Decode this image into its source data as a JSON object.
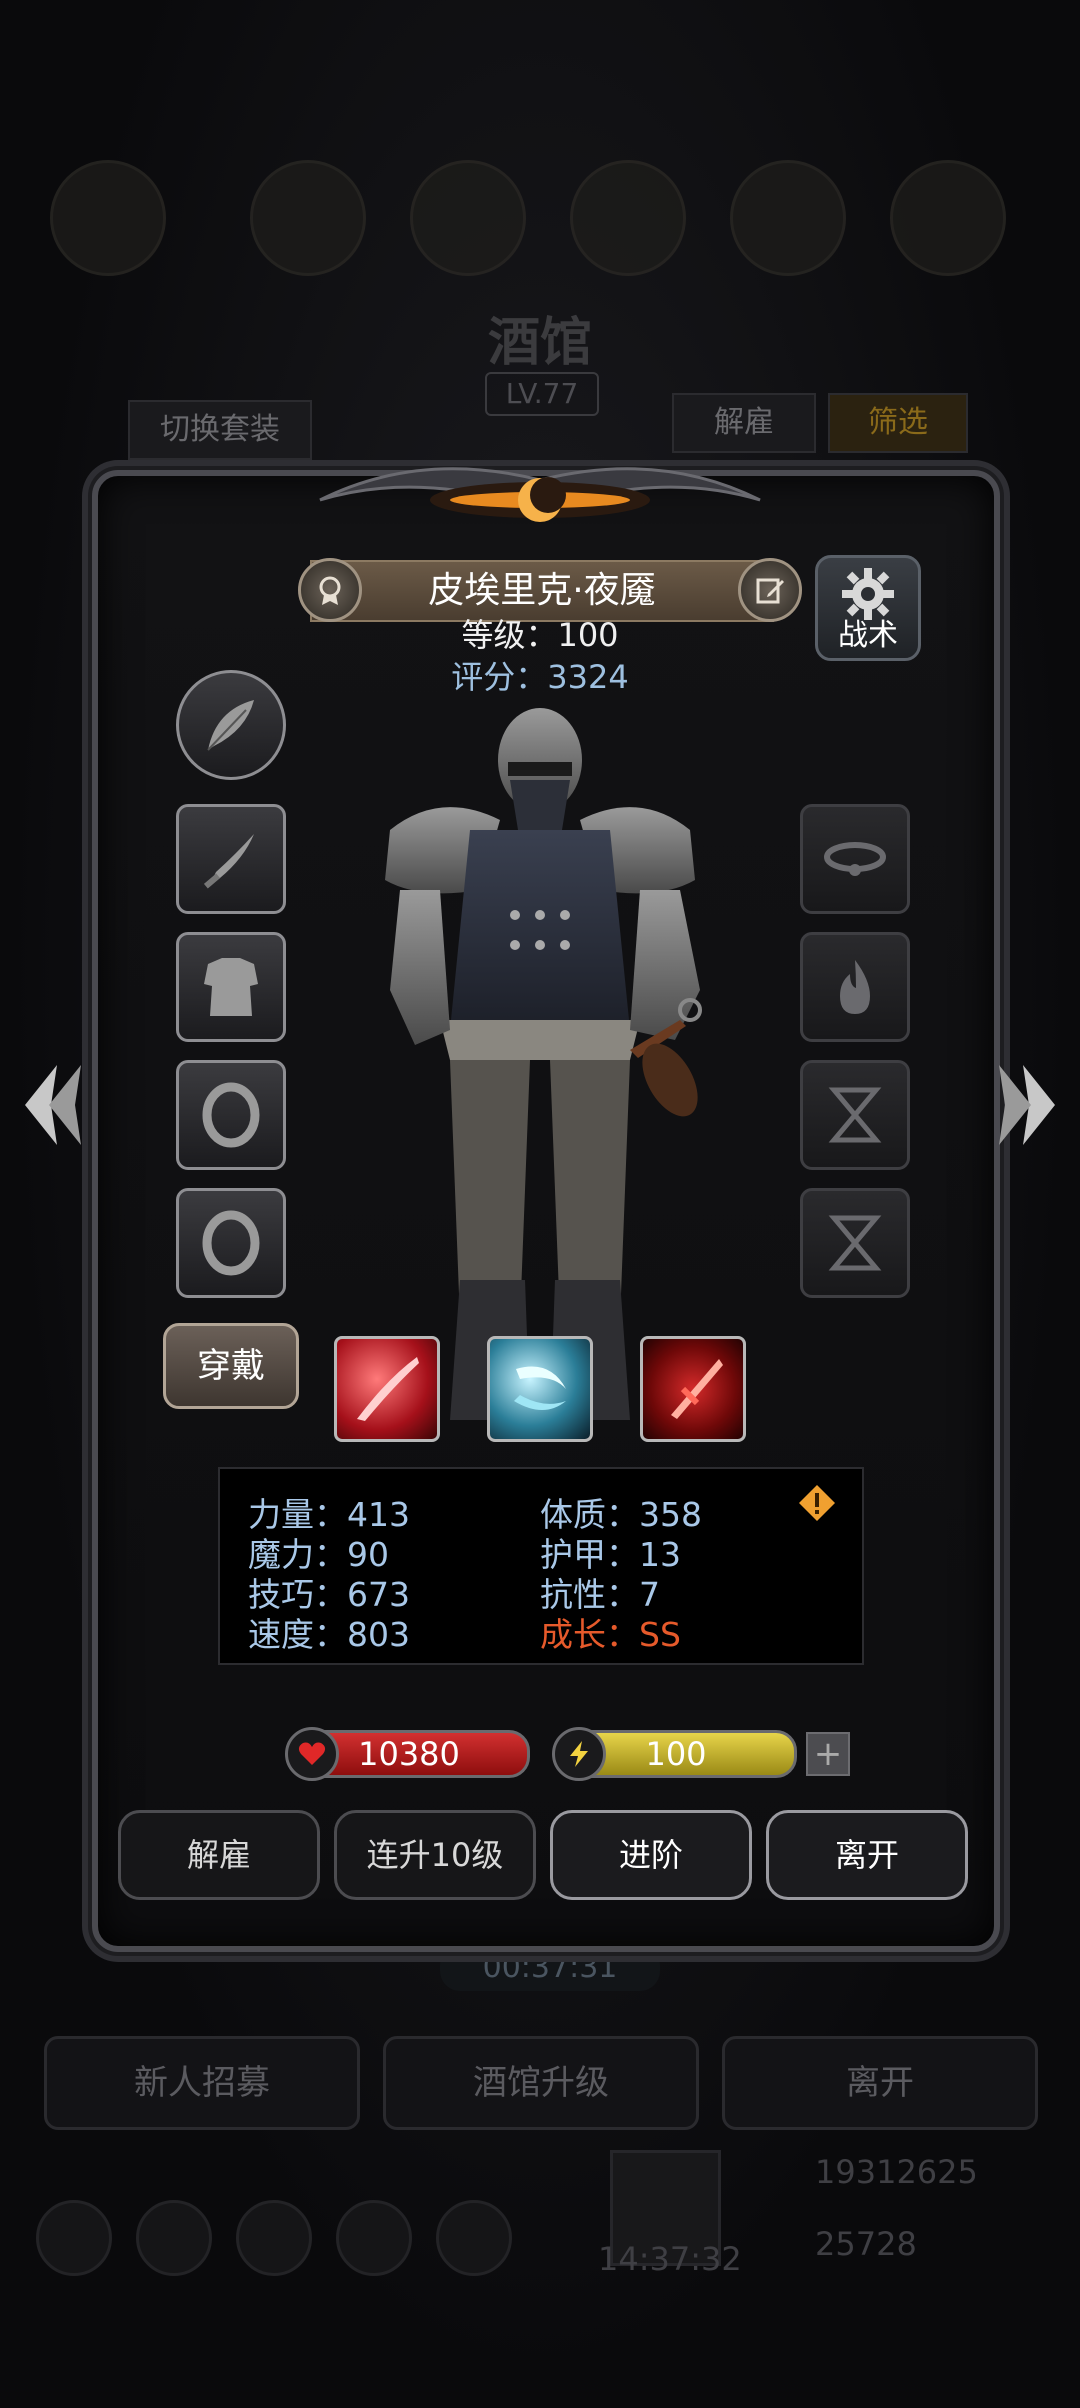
{
  "background": {
    "title": "酒馆",
    "level": "LV.77",
    "switch_set": "切换套装",
    "dismiss": "解雇",
    "filter": "筛选",
    "timer": "00:37:31",
    "recruit": "新人招募",
    "tavern_upgrade": "酒馆升级",
    "leave": "离开",
    "gold": "19312625",
    "gems": "25728",
    "gift_timer": "14:37:32"
  },
  "hero": {
    "name": "皮埃里克·夜魇",
    "level_text": "等级：100",
    "score_text": "评分：3324",
    "tactics": "战术",
    "wear": "穿戴"
  },
  "stats": {
    "strength": "力量：413",
    "magic": "魔力：90",
    "skill": "技巧：673",
    "speed": "速度：803",
    "constitution": "体质：358",
    "armor": "护甲：13",
    "resistance": "抗性：7",
    "growth": "成长：SS"
  },
  "bars": {
    "hp": "10380",
    "energy": "100"
  },
  "actions": {
    "dismiss": "解雇",
    "level_up_10": "连升10级",
    "advance": "进阶",
    "leave": "离开"
  },
  "colors": {
    "stat_text": "#a9c8e8",
    "growth": "#e65a2b",
    "hp": "#c81e1e",
    "energy": "#d9c63a"
  }
}
